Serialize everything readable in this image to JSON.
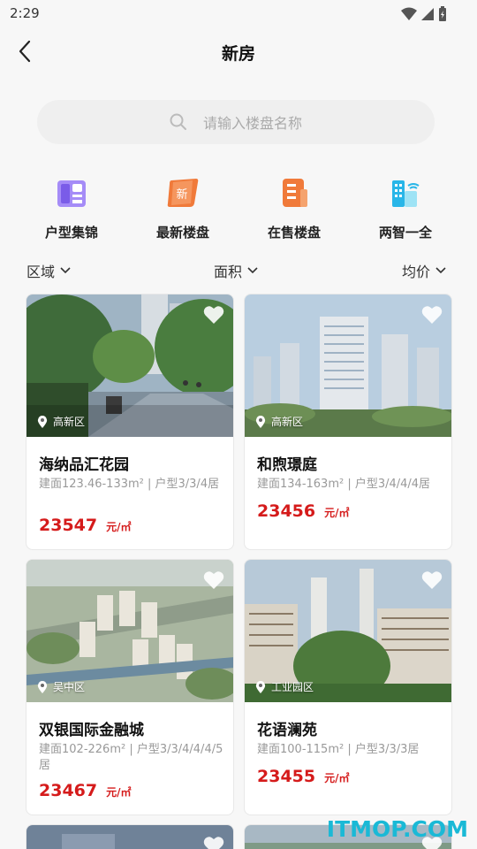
{
  "status_bar": {
    "time": "2:29"
  },
  "nav": {
    "title": "新房"
  },
  "search": {
    "placeholder": "请输入楼盘名称"
  },
  "quick_nav": [
    {
      "label": "户型集锦",
      "icon": "floorplan-icon"
    },
    {
      "label": "最新楼盘",
      "icon": "new-badge-icon",
      "badge": "新"
    },
    {
      "label": "在售楼盘",
      "icon": "building-icon"
    },
    {
      "label": "两智一全",
      "icon": "smart-building-icon"
    }
  ],
  "filters": {
    "area_label": "区域",
    "size_label": "面积",
    "price_label": "均价"
  },
  "listings": [
    {
      "name": "海纳品汇花园",
      "district": "高新区",
      "spec": "建面123.46-133m² | 户型3/3/4居",
      "price": "23547",
      "unit": "元/㎡"
    },
    {
      "name": "和煦璟庭",
      "district": "高新区",
      "spec": "建面134-163m² | 户型3/4/4/4居",
      "price": "23456",
      "unit": "元/㎡"
    },
    {
      "name": "双银国际金融城",
      "district": "吴中区",
      "spec": "建面102-226m² | 户型3/3/4/4/4/5居",
      "price": "23467",
      "unit": "元/㎡"
    },
    {
      "name": "花语澜苑",
      "district": "工业园区",
      "spec": "建面100-115m² | 户型3/3/3居",
      "price": "23455",
      "unit": "元/㎡"
    }
  ],
  "watermark": "ITMOP.COM",
  "colors": {
    "price": "#d51b1b",
    "accent_orange": "#f07a3a",
    "accent_purple": "#8a6cf0",
    "accent_cyan": "#29b6e8"
  }
}
